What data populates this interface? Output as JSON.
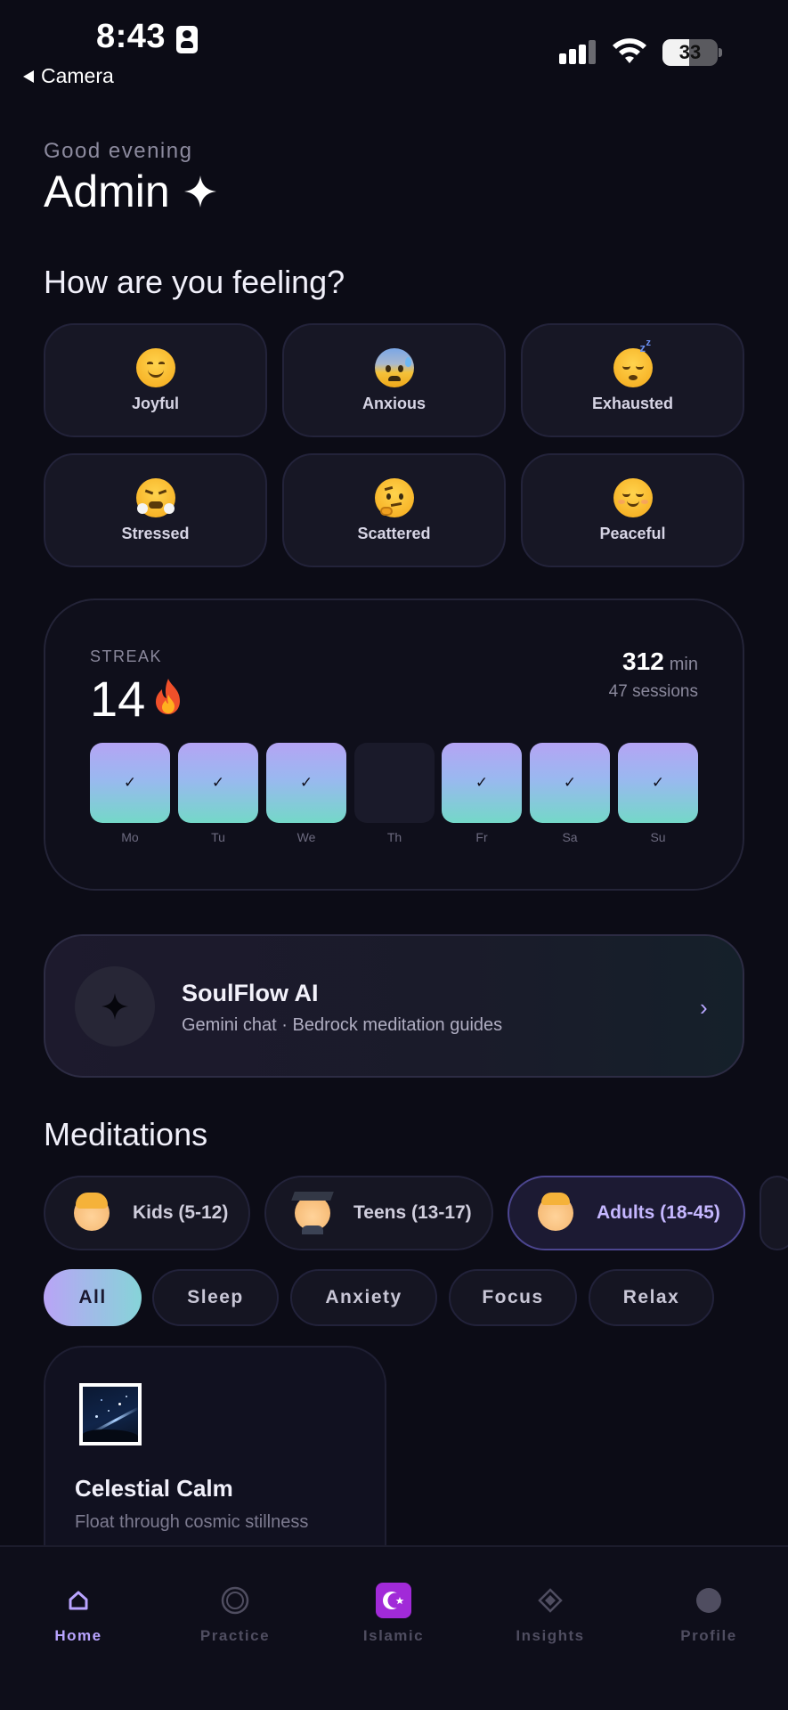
{
  "status_bar": {
    "time": "8:43",
    "back_label": "Camera",
    "battery": "33"
  },
  "header": {
    "greeting": "Good evening",
    "name": "Admin"
  },
  "mood_section": {
    "title": "How are you feeling?",
    "moods": [
      {
        "label": "Joyful",
        "icon": "smiling-face-icon"
      },
      {
        "label": "Anxious",
        "icon": "anxious-face-icon"
      },
      {
        "label": "Exhausted",
        "icon": "sleeping-face-icon"
      },
      {
        "label": "Stressed",
        "icon": "steaming-face-icon"
      },
      {
        "label": "Scattered",
        "icon": "thinking-face-icon"
      },
      {
        "label": "Peaceful",
        "icon": "relieved-face-icon"
      }
    ]
  },
  "streak": {
    "label": "STREAK",
    "count": "14",
    "minutes": "312",
    "minutes_unit": "min",
    "sessions": "47 sessions",
    "check": "✓",
    "days": [
      {
        "label": "Mo",
        "done": true
      },
      {
        "label": "Tu",
        "done": true
      },
      {
        "label": "We",
        "done": true
      },
      {
        "label": "Th",
        "done": false
      },
      {
        "label": "Fr",
        "done": true
      },
      {
        "label": "Sa",
        "done": true
      },
      {
        "label": "Su",
        "done": true
      }
    ]
  },
  "ai_card": {
    "title": "SoulFlow AI",
    "subtitle": "Gemini chat · Bedrock meditation guides",
    "chevron": "›"
  },
  "meditations": {
    "title": "Meditations",
    "age_groups": [
      {
        "label": "Kids (5-12)",
        "active": false
      },
      {
        "label": "Teens (13-17)",
        "active": false
      },
      {
        "label": "Adults (18-45)",
        "active": true
      }
    ],
    "categories": [
      {
        "label": "All",
        "active": true
      },
      {
        "label": "Sleep",
        "active": false
      },
      {
        "label": "Anxiety",
        "active": false
      },
      {
        "label": "Focus",
        "active": false
      },
      {
        "label": "Relax",
        "active": false
      }
    ],
    "card": {
      "title": "Celestial Calm",
      "subtitle": "Float through cosmic stillness"
    }
  },
  "tabbar": {
    "tabs": [
      {
        "label": "Home",
        "icon": "home-icon",
        "active": true
      },
      {
        "label": "Practice",
        "icon": "circle-icon",
        "active": false
      },
      {
        "label": "Islamic",
        "icon": "crescent-star-icon",
        "active": false
      },
      {
        "label": "Insights",
        "icon": "diamond-icon",
        "active": false
      },
      {
        "label": "Profile",
        "icon": "profile-dot-icon",
        "active": false
      }
    ]
  },
  "colors": {
    "accent": "#b9a4ff",
    "gradient_start": "#b5a4f4",
    "gradient_end": "#74d8c8",
    "background": "#0c0c16"
  }
}
